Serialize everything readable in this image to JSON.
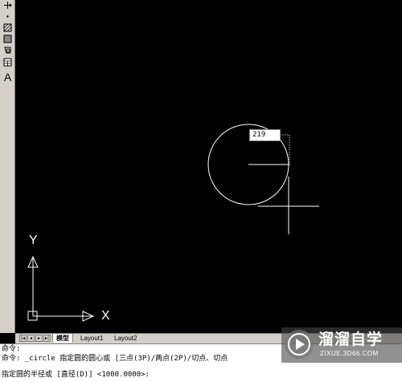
{
  "toolbar": {
    "items": [
      "move-icon",
      "point-icon",
      "hatch-icon",
      "gradient-icon",
      "region-icon",
      "table-icon",
      "multiline-text-icon"
    ],
    "text_tool_glyph": "A"
  },
  "canvas": {
    "radius_input": "219",
    "ucs": {
      "x_label": "X",
      "y_label": "Y"
    }
  },
  "tabs": {
    "nav_icons": [
      "first-tab-icon",
      "prev-tab-icon",
      "next-tab-icon",
      "last-tab-icon"
    ],
    "items": [
      {
        "label": "模型",
        "active": true
      },
      {
        "label": "Layout1",
        "active": false
      },
      {
        "label": "Layout2",
        "active": false
      }
    ]
  },
  "command_line": {
    "lines": [
      "命令:",
      "命令: _circle 指定圆的圆心或 [三点(3P)/两点(2P)/切点、切点",
      "指定圆的半径或 [直径(D)] <1000.0000>:"
    ]
  },
  "watermark": {
    "title": "溜溜自学",
    "url": "ZIXUE.3D66.COM"
  }
}
